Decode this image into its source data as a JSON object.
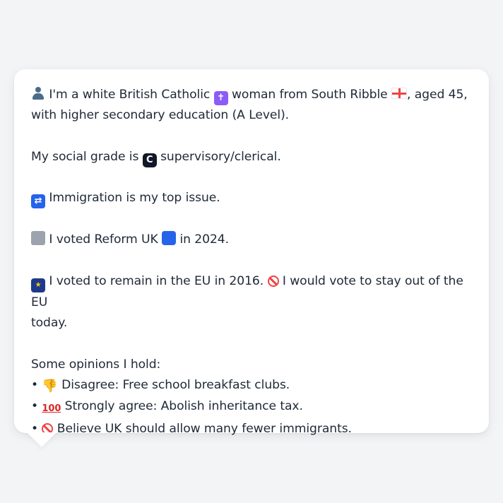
{
  "message": {
    "line1_a": "I'm a white British Catholic",
    "line1_b": "woman from South Ribble",
    "line1_c": ", aged 45,",
    "line2": "with higher secondary education (A Level).",
    "social_a": "My social grade is",
    "social_grade_letter": "C",
    "social_b": "supervisory/clerical.",
    "issue": "Immigration is my top issue.",
    "vote_a": "I voted Reform UK",
    "vote_b": "in 2024.",
    "eu_a": "I voted to remain in the EU in 2016.",
    "eu_b": "I would vote to stay out of the EU",
    "eu_c": "today.",
    "opinions_header": "Some opinions I hold:",
    "opinions": [
      {
        "bullet": "•",
        "text": "Disagree: Free school breakfast clubs."
      },
      {
        "bullet": "•",
        "text": "Strongly agree: Abolish inheritance tax."
      },
      {
        "bullet": "•",
        "text": "Believe UK should allow many fewer immigrants."
      }
    ]
  },
  "icons": {
    "person": "person-silhouette-icon",
    "cross": "latin-cross-icon",
    "flag": "england-flag-icon",
    "grade": "letter-c-icon",
    "immigration": "passport-control-icon",
    "ballot": "ballot-box-icon",
    "reform": "blue-square-icon",
    "eu": "eu-flag-icon",
    "no_entry": "prohibited-icon",
    "thumbs_down": "thumbs-down-icon",
    "hundred": "hundred-points-icon"
  },
  "colors": {
    "background": "#f3f4f6",
    "bubble": "#ffffff",
    "text": "#1f2937"
  }
}
